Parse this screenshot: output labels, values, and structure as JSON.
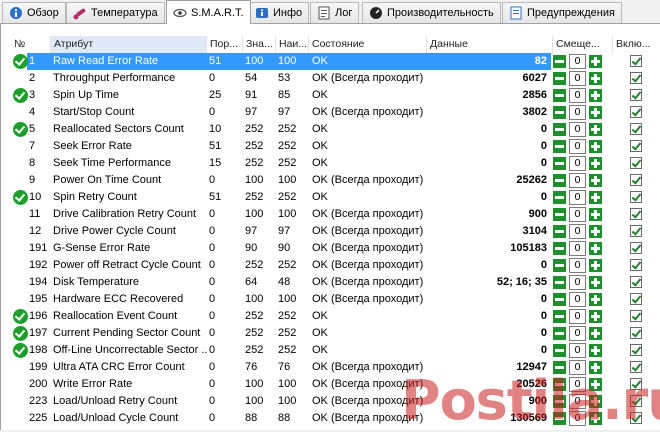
{
  "tabs": [
    {
      "label": "Обзор",
      "icon": "info-circle-icon"
    },
    {
      "label": "Температура",
      "icon": "thermometer-icon"
    },
    {
      "label": "S.M.A.R.T.",
      "icon": "smart-eye-icon",
      "active": true
    },
    {
      "label": "Инфо",
      "icon": "info-icon"
    },
    {
      "label": "Лог",
      "icon": "log-icon"
    },
    {
      "label": "Производительность",
      "icon": "gauge-icon"
    },
    {
      "label": "Предупреждения",
      "icon": "warnings-icon"
    }
  ],
  "columns": {
    "num": "№",
    "attr": "Атрибут",
    "thr": "Пор...",
    "val": "Зна...",
    "worst": "Наи...",
    "state": "Состояние",
    "data": "Данные",
    "offset": "Смеще...",
    "enabled": "Вклю..."
  },
  "rows": [
    {
      "ok": true,
      "num": "1",
      "attr": "Raw Read Error Rate",
      "thr": "51",
      "val": "100",
      "worst": "100",
      "state": "OK",
      "data": "82",
      "offset": "0",
      "selected": true
    },
    {
      "ok": false,
      "num": "2",
      "attr": "Throughput Performance",
      "thr": "0",
      "val": "54",
      "worst": "53",
      "state": "OK (Всегда проходит)",
      "data": "6027",
      "offset": "0"
    },
    {
      "ok": true,
      "num": "3",
      "attr": "Spin Up Time",
      "thr": "25",
      "val": "91",
      "worst": "85",
      "state": "OK",
      "data": "2856",
      "offset": "0"
    },
    {
      "ok": false,
      "num": "4",
      "attr": "Start/Stop Count",
      "thr": "0",
      "val": "97",
      "worst": "97",
      "state": "OK (Всегда проходит)",
      "data": "3802",
      "offset": "0"
    },
    {
      "ok": true,
      "num": "5",
      "attr": "Reallocated Sectors Count",
      "thr": "10",
      "val": "252",
      "worst": "252",
      "state": "OK",
      "data": "0",
      "offset": "0"
    },
    {
      "ok": false,
      "num": "7",
      "attr": "Seek Error Rate",
      "thr": "51",
      "val": "252",
      "worst": "252",
      "state": "OK",
      "data": "0",
      "offset": "0"
    },
    {
      "ok": false,
      "num": "8",
      "attr": "Seek Time Performance",
      "thr": "15",
      "val": "252",
      "worst": "252",
      "state": "OK",
      "data": "0",
      "offset": "0"
    },
    {
      "ok": false,
      "num": "9",
      "attr": "Power On Time Count",
      "thr": "0",
      "val": "100",
      "worst": "100",
      "state": "OK (Всегда проходит)",
      "data": "25262",
      "offset": "0"
    },
    {
      "ok": true,
      "num": "10",
      "attr": "Spin Retry Count",
      "thr": "51",
      "val": "252",
      "worst": "252",
      "state": "OK",
      "data": "0",
      "offset": "0"
    },
    {
      "ok": false,
      "num": "11",
      "attr": "Drive Calibration Retry Count",
      "thr": "0",
      "val": "100",
      "worst": "100",
      "state": "OK (Всегда проходит)",
      "data": "900",
      "offset": "0"
    },
    {
      "ok": false,
      "num": "12",
      "attr": "Drive Power Cycle Count",
      "thr": "0",
      "val": "97",
      "worst": "97",
      "state": "OK (Всегда проходит)",
      "data": "3104",
      "offset": "0"
    },
    {
      "ok": false,
      "num": "191",
      "attr": "G-Sense Error Rate",
      "thr": "0",
      "val": "90",
      "worst": "90",
      "state": "OK (Всегда проходит)",
      "data": "105183",
      "offset": "0"
    },
    {
      "ok": false,
      "num": "192",
      "attr": "Power off Retract Cycle Count",
      "thr": "0",
      "val": "252",
      "worst": "252",
      "state": "OK (Всегда проходит)",
      "data": "0",
      "offset": "0"
    },
    {
      "ok": false,
      "num": "194",
      "attr": "Disk Temperature",
      "thr": "0",
      "val": "64",
      "worst": "48",
      "state": "OK (Всегда проходит)",
      "data": "52; 16; 35",
      "offset": "0"
    },
    {
      "ok": false,
      "num": "195",
      "attr": "Hardware ECC Recovered",
      "thr": "0",
      "val": "100",
      "worst": "100",
      "state": "OK (Всегда проходит)",
      "data": "0",
      "offset": "0"
    },
    {
      "ok": true,
      "num": "196",
      "attr": "Reallocation Event Count",
      "thr": "0",
      "val": "252",
      "worst": "252",
      "state": "OK",
      "data": "0",
      "offset": "0"
    },
    {
      "ok": true,
      "num": "197",
      "attr": "Current Pending Sector Count",
      "thr": "0",
      "val": "252",
      "worst": "252",
      "state": "OK",
      "data": "0",
      "offset": "0"
    },
    {
      "ok": true,
      "num": "198",
      "attr": "Off-Line Uncorrectable Sector ...",
      "thr": "0",
      "val": "252",
      "worst": "252",
      "state": "OK",
      "data": "0",
      "offset": "0"
    },
    {
      "ok": false,
      "num": "199",
      "attr": "Ultra ATA CRC Error Count",
      "thr": "0",
      "val": "76",
      "worst": "76",
      "state": "OK (Всегда проходит)",
      "data": "12947",
      "offset": "0"
    },
    {
      "ok": false,
      "num": "200",
      "attr": "Write Error Rate",
      "thr": "0",
      "val": "100",
      "worst": "100",
      "state": "OK (Всегда проходит)",
      "data": "20526",
      "offset": "0"
    },
    {
      "ok": false,
      "num": "223",
      "attr": "Load/Unload Retry Count",
      "thr": "0",
      "val": "100",
      "worst": "100",
      "state": "OK (Всегда проходит)",
      "data": "900",
      "offset": "0"
    },
    {
      "ok": false,
      "num": "225",
      "attr": "Load/Unload Cycle Count",
      "thr": "0",
      "val": "88",
      "worst": "88",
      "state": "OK (Всегда проходит)",
      "data": "130569",
      "offset": "0"
    }
  ],
  "watermark": "Postila.ru",
  "colors": {
    "selection": "#3399ff",
    "ok_green": "#1e9f2c",
    "button_green": "#1e8f2c"
  }
}
